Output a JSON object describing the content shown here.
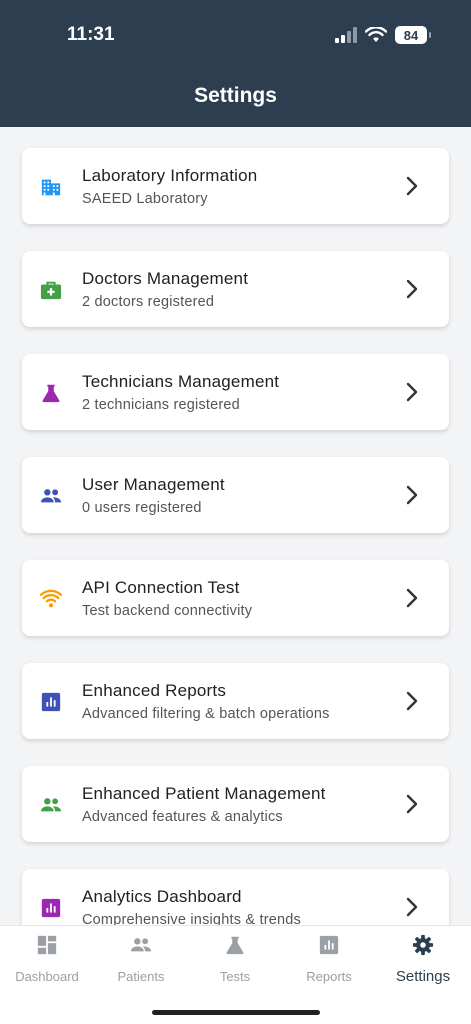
{
  "status": {
    "time": "11:31",
    "battery": "84"
  },
  "header": {
    "title": "Settings"
  },
  "items": [
    {
      "title": "Laboratory Information",
      "subtitle": "SAEED Laboratory",
      "icon": "building-icon",
      "color": "#2196f3"
    },
    {
      "title": "Doctors Management",
      "subtitle": "2 doctors registered",
      "icon": "medical-bag-icon",
      "color": "#43a047"
    },
    {
      "title": "Technicians Management",
      "subtitle": "2 technicians registered",
      "icon": "flask-icon",
      "color": "#9c27b0"
    },
    {
      "title": "User Management",
      "subtitle": "0 users registered",
      "icon": "people-icon",
      "color": "#3f51b5"
    },
    {
      "title": "API Connection Test",
      "subtitle": "Test backend connectivity",
      "icon": "wifi-icon",
      "color": "#ff9800"
    },
    {
      "title": "Enhanced Reports",
      "subtitle": "Advanced filtering & batch operations",
      "icon": "chart-box-icon",
      "color": "#3f51b5"
    },
    {
      "title": "Enhanced Patient Management",
      "subtitle": "Advanced features & analytics",
      "icon": "people-icon",
      "color": "#43a047"
    },
    {
      "title": "Analytics Dashboard",
      "subtitle": "Comprehensive insights & trends",
      "icon": "chart-box-icon",
      "color": "#9c27b0"
    }
  ],
  "tabs": [
    {
      "label": "Dashboard",
      "icon": "dashboard-icon"
    },
    {
      "label": "Patients",
      "icon": "people-icon"
    },
    {
      "label": "Tests",
      "icon": "flask-icon"
    },
    {
      "label": "Reports",
      "icon": "chart-box-icon"
    },
    {
      "label": "Settings",
      "icon": "gear-icon",
      "active": true
    }
  ],
  "colors": {
    "header": "#2c3e50",
    "inactive_tab": "#9aa0a6",
    "active_tab": "#2c3e50"
  }
}
